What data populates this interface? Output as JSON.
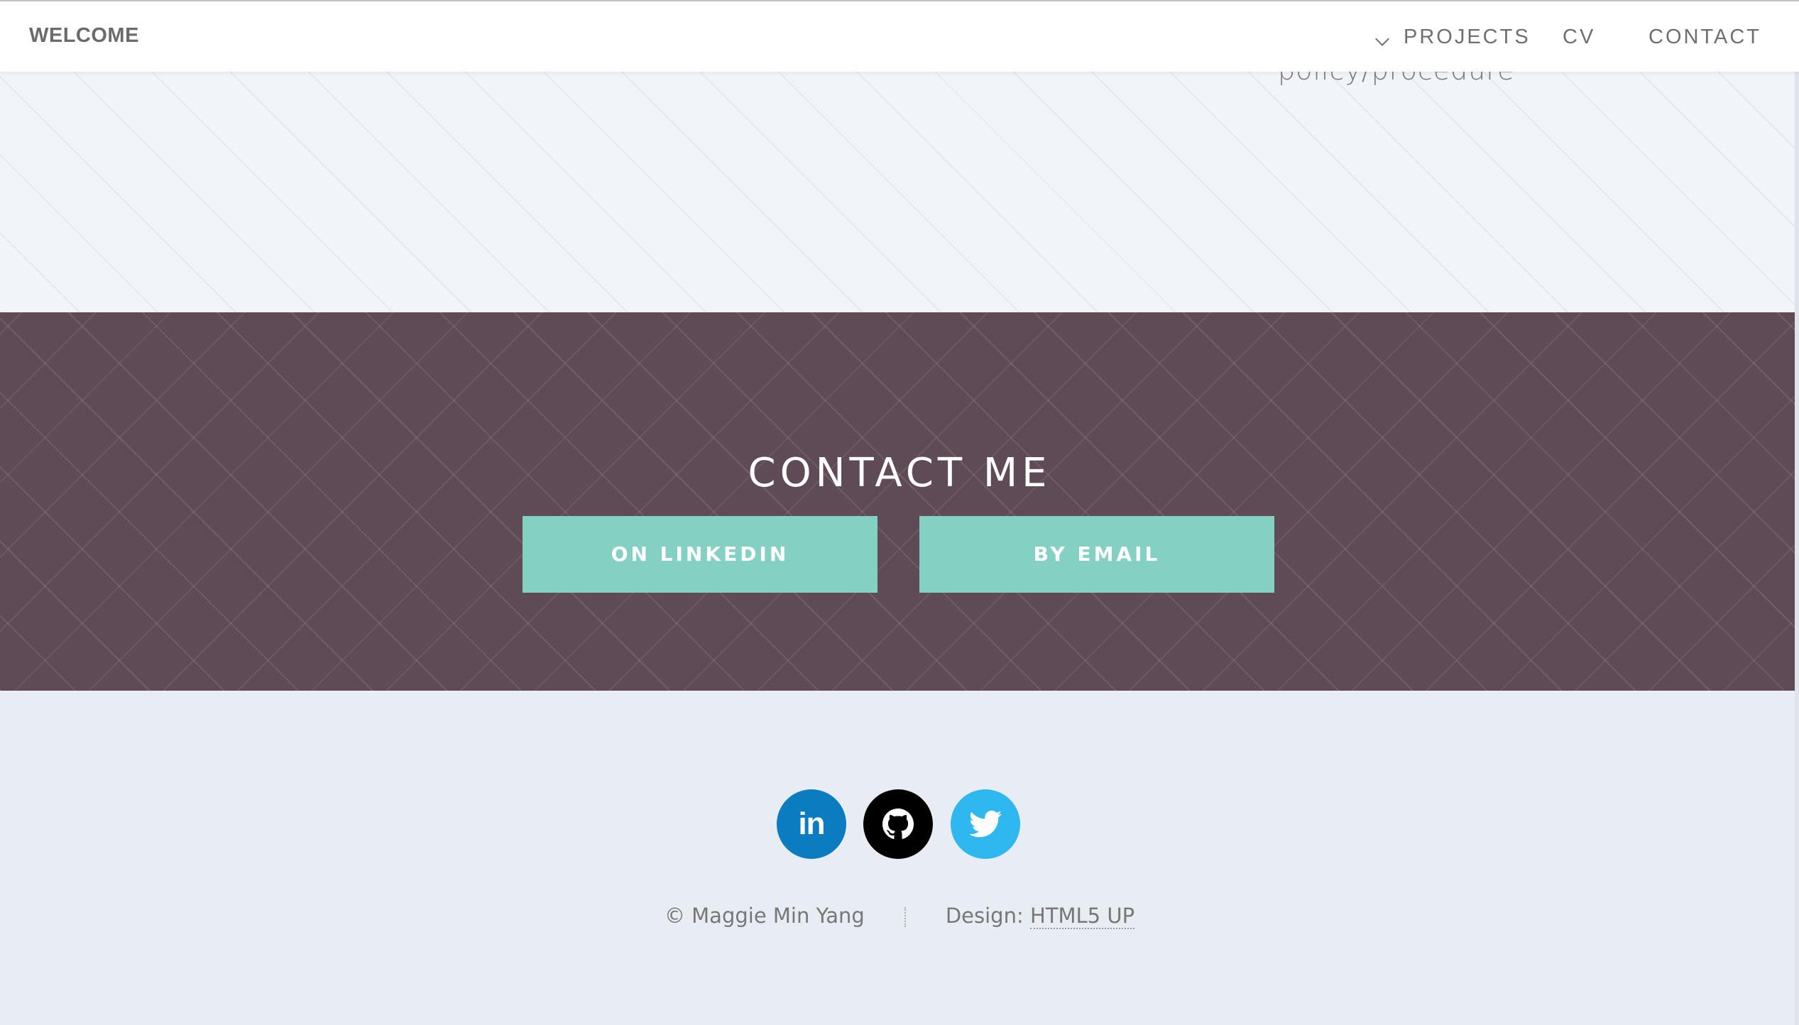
{
  "header": {
    "brand": "WELCOME",
    "nav": [
      {
        "label": "PROJECTS",
        "icon": "chevron-down-icon"
      },
      {
        "label": "CV"
      },
      {
        "label": "CONTACT"
      }
    ]
  },
  "top_section": {
    "text": "policy/procedure"
  },
  "contact": {
    "title": "CONTACT ME",
    "buttons": {
      "linkedin": "ON LINKEDIN",
      "email": "BY EMAIL"
    }
  },
  "footer": {
    "social": [
      {
        "name": "linkedin-icon",
        "label": "in",
        "color": "#0b7cbf"
      },
      {
        "name": "github-icon",
        "color": "#000000"
      },
      {
        "name": "twitter-icon",
        "color": "#2fb7ef"
      }
    ],
    "copyright": "© Maggie Min Yang",
    "design_prefix": "Design: ",
    "design_link": "HTML5 UP"
  },
  "colors": {
    "accent": "#84d1c4",
    "contact_bg": "#5f4b56",
    "footer_bg": "#e8edf4"
  }
}
